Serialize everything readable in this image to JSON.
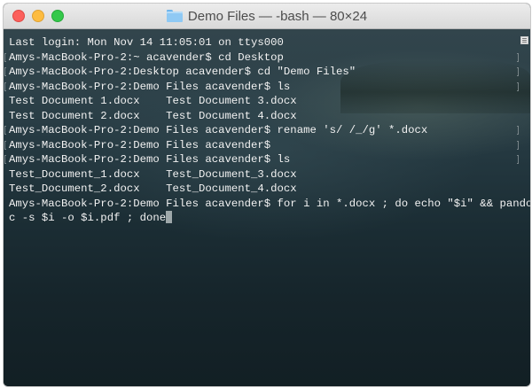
{
  "window": {
    "title": "Demo Files — -bash — 80×24",
    "controls": [
      "close-button",
      "minimize-button",
      "zoom-button"
    ],
    "icon": "folder-icon"
  },
  "terminal": {
    "lines": [
      {
        "text": "Last login: Mon Nov 14 11:05:01 on ttys000",
        "marked": false
      },
      {
        "text": "Amys-MacBook-Pro-2:~ acavender$ cd Desktop",
        "marked": true
      },
      {
        "text": "Amys-MacBook-Pro-2:Desktop acavender$ cd \"Demo Files\"",
        "marked": true
      },
      {
        "text": "Amys-MacBook-Pro-2:Demo Files acavender$ ls",
        "marked": true
      },
      {
        "text": "Test Document 1.docx    Test Document 3.docx",
        "marked": false
      },
      {
        "text": "Test Document 2.docx    Test Document 4.docx",
        "marked": false
      },
      {
        "text": "Amys-MacBook-Pro-2:Demo Files acavender$ rename 's/ /_/g' *.docx",
        "marked": true
      },
      {
        "text": "Amys-MacBook-Pro-2:Demo Files acavender$",
        "marked": true
      },
      {
        "text": "Amys-MacBook-Pro-2:Demo Files acavender$ ls",
        "marked": true
      },
      {
        "text": "Test_Document_1.docx    Test_Document_3.docx",
        "marked": false
      },
      {
        "text": "Test_Document_2.docx    Test_Document_4.docx",
        "marked": false
      },
      {
        "text": "Amys-MacBook-Pro-2:Demo Files acavender$ for i in *.docx ; do echo \"$i\" && pando",
        "marked": false
      },
      {
        "text": "c -s $i -o $i.pdf ; done",
        "marked": false,
        "cursor": true
      }
    ]
  },
  "colors": {
    "close": "#fc605c",
    "minimize": "#fdbc40",
    "zoom": "#34c84a",
    "text": "#f2f2f2"
  }
}
